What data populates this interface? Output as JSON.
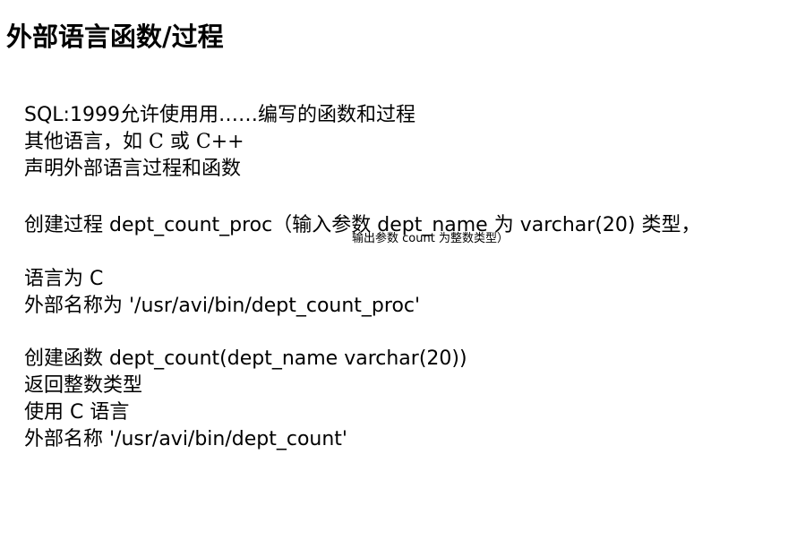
{
  "slide": {
    "title": "外部语言函数/过程"
  },
  "intro": {
    "line1": "SQL:1999允许使用用……编写的函数和过程",
    "line2_prefix": "其他语言，如",
    "line2_math1": "C",
    "line2_or": "或",
    "line2_math2": "C++",
    "line3": "声明外部语言过程和函数"
  },
  "procedure": {
    "line1": "创建过程 dept_count_proc（输入参数 dept_name 为 varchar(20) 类型，",
    "line1_cont": "输出参数 count 为整数类型）",
    "line2": "语言为 C",
    "line3": "外部名称为 '/usr/avi/bin/dept_count_proc'"
  },
  "function": {
    "line1": "创建函数 dept_count(dept_name varchar(20))",
    "line2": "返回整数类型",
    "line3": "使用 C 语言",
    "line4": "外部名称 '/usr/avi/bin/dept_count'"
  }
}
